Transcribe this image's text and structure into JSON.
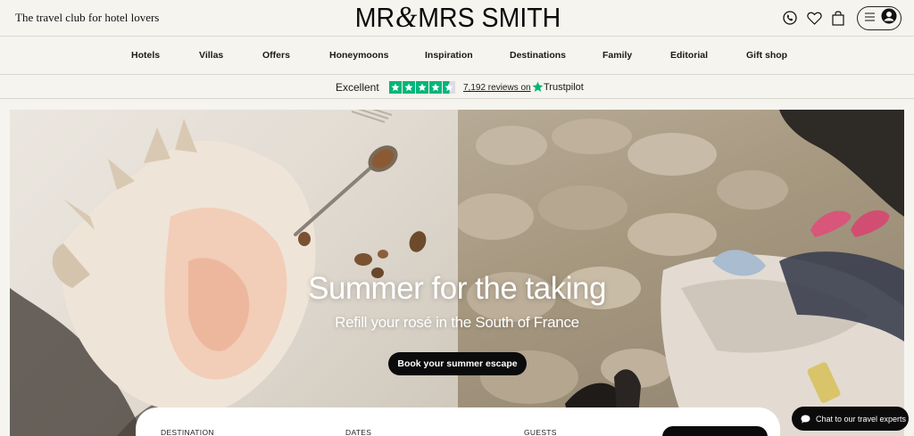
{
  "header": {
    "tagline": "The travel club for hotel lovers",
    "logo_left": "MR",
    "logo_amp": "&",
    "logo_right": "MRS SMITH",
    "icons": [
      "phone-icon",
      "heart-icon",
      "bag-icon",
      "menu-icon",
      "account-icon"
    ]
  },
  "nav": {
    "items": [
      {
        "label": "Hotels"
      },
      {
        "label": "Villas"
      },
      {
        "label": "Offers"
      },
      {
        "label": "Honeymoons"
      },
      {
        "label": "Inspiration"
      },
      {
        "label": "Destinations"
      },
      {
        "label": "Family"
      },
      {
        "label": "Editorial"
      },
      {
        "label": "Gift shop"
      }
    ]
  },
  "trustpilot": {
    "rating_text": "Excellent",
    "stars": 4.5,
    "reviews": "7,192 reviews on",
    "brand": "Trustpilot",
    "star_color": "#00b67a"
  },
  "hero": {
    "title": "Summer for the taking",
    "subtitle": "Refill your rosé in the South of France",
    "cta": "Book your summer escape"
  },
  "search": {
    "destination_label": "DESTINATION",
    "dates_label": "DATES",
    "guests_label": "GUESTS"
  },
  "chat": {
    "label": "Chat to our travel experts"
  }
}
